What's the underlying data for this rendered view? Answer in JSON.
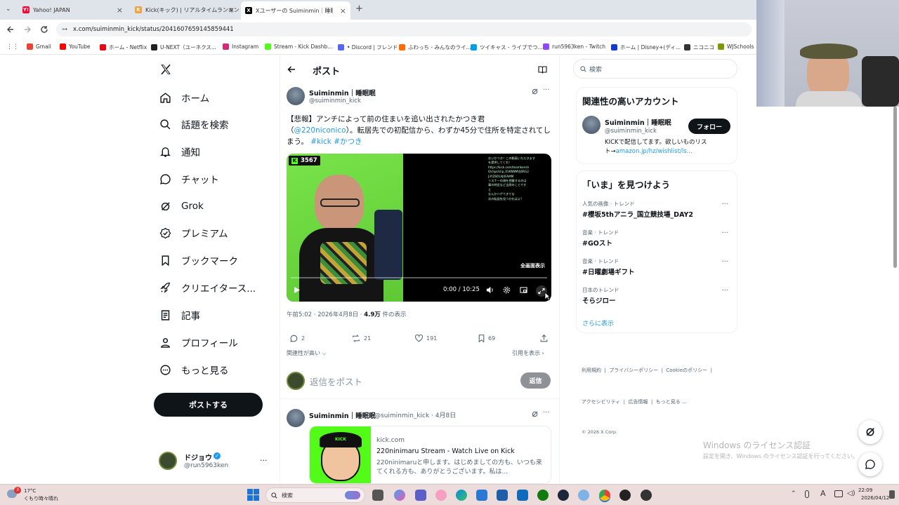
{
  "browser": {
    "tabs": [
      {
        "label": "Yahoo! JAPAN",
        "fav_color": "#ff0033",
        "fav_glyph": "Y!"
      },
      {
        "label": "Kick(キック) | リアルタイムランキング",
        "fav_color": "#f2a23a",
        "fav_glyph": "K"
      },
      {
        "label": "Xユーザーの Suiminmin｜睡眠眠さ",
        "fav_color": "#000000",
        "fav_glyph": "X"
      }
    ],
    "new_tab_glyph": "+",
    "url": "x.com/suiminmin_kick/status/2041607659145859441",
    "bookmarks": [
      {
        "label": "Gmail",
        "color": "#ea4335"
      },
      {
        "label": "YouTube",
        "color": "#ff0000"
      },
      {
        "label": "ホーム - Netflix",
        "color": "#e50914"
      },
      {
        "label": "U-NEXT（ユーネクス...",
        "color": "#222222"
      },
      {
        "label": "Instagram",
        "color": "#d62976"
      },
      {
        "label": "Stream - Kick Dashb...",
        "color": "#53fc18"
      },
      {
        "label": "• Discord | フレンド",
        "color": "#5865f2"
      },
      {
        "label": "ふわっち - みんなのライ...",
        "color": "#ff6a00"
      },
      {
        "label": "ツイキャス - ライブでつ...",
        "color": "#00a0e9"
      },
      {
        "label": "run5963ken - Twitch",
        "color": "#9146ff"
      },
      {
        "label": "ホーム | Disney+(ディ...",
        "color": "#113ccf"
      },
      {
        "label": "ニコニコ",
        "color": "#333333"
      },
      {
        "label": "WJSchools",
        "color": "#7a9a01"
      }
    ]
  },
  "nav": {
    "items": [
      {
        "label": "ホーム",
        "icon": "home-icon"
      },
      {
        "label": "話題を検索",
        "icon": "search-icon"
      },
      {
        "label": "通知",
        "icon": "bell-icon"
      },
      {
        "label": "チャット",
        "icon": "chat-icon"
      },
      {
        "label": "Grok",
        "icon": "grok-icon"
      },
      {
        "label": "プレミアム",
        "icon": "premium-icon"
      },
      {
        "label": "ブックマーク",
        "icon": "bookmark-icon"
      },
      {
        "label": "クリエイタース...",
        "icon": "rocket-icon"
      },
      {
        "label": "記事",
        "icon": "article-icon"
      },
      {
        "label": "プロフィール",
        "icon": "profile-icon"
      },
      {
        "label": "もっと見る",
        "icon": "more-icon"
      }
    ],
    "post_button": "ポストする",
    "account": {
      "name": "ドジョウ",
      "handle": "@run5963ken",
      "more": "···"
    }
  },
  "header": {
    "title": "ポスト"
  },
  "post": {
    "author_name": "Suiminmin｜睡眠眠",
    "author_handle": "@suiminmin_kick",
    "text_1": "【悲報】アンチによって前の住まいを追い出されたかつき君（",
    "mention": "@220niconico",
    "text_2": "）。転居先での初配信から、わずか45分で住所を特定されてしまう。",
    "hashtags": "#kick #かつき",
    "video": {
      "kick_viewers": "3567",
      "time": "0:00 / 10:25",
      "fullscreen_label": "全画面表示",
      "chat_lines": [
        "おいかつき！この動画いただきます",
        "を提供してくれ！",
        "https://kick.com/teamkensh",
        "0/clips/clip_01KNNMVJ6RG2",
        "J3YZ601AJ0FAMM",
        "リスナーの顔を把握するのは",
        "事の特定など当然のことです",
        "と",
        "なんかハゲてきてな",
        "次の転居先見つかればよ？"
      ]
    },
    "meta_time": "午前5:02 · 2026年4月8日 · ",
    "views_count": "4.9万",
    "views_label": " 件の表示",
    "actions": {
      "replies": "2",
      "reposts": "21",
      "likes": "191",
      "bookmarks": "69"
    },
    "sort_label": "関連性が高い",
    "quotes_label": "引用を表示",
    "reply_placeholder": "返信をポスト",
    "reply_button": "返信"
  },
  "reply_post": {
    "author_name": "Suiminmin｜睡眠眠",
    "author_meta": "@suiminmin_kick · 4月8日",
    "link_domain": "kick.com",
    "link_title": "220ninimaru Stream - Watch Live on Kick",
    "link_desc": "220ninimaruと申します。はじめましての方も、いつも来てくれる方も、ありがとうございます。私は..."
  },
  "search": {
    "placeholder": "検索"
  },
  "related": {
    "title": "関連性の高いアカウント",
    "name": "Suiminmin｜睡眠眠",
    "handle": "@suiminmin_kick",
    "follow": "フォロー",
    "bio_1": "KICKで配信してます。欲しいものリス",
    "bio_2": "ト→",
    "bio_link": "amazon.jp/hz/wishlist/ls..."
  },
  "trends": {
    "title": "「いま」を見つけよう",
    "items": [
      {
        "category": "人気の画像 · トレンド",
        "name": "#櫻坂5thアニラ_国立競技場_DAY2"
      },
      {
        "category": "音楽 · トレンド",
        "name": "#GOスト"
      },
      {
        "category": "音楽 · トレンド",
        "name": "#日曜劇場ギフト"
      },
      {
        "category": "日本のトレンド",
        "name": "そらジロー"
      }
    ],
    "more": "さらに表示"
  },
  "footer": {
    "row1": "利用規約  |  プライバシーポリシー  |  Cookieのポリシー  |",
    "row2": "アクセシビリティ  |  広告情報  |  もっと見る ...",
    "row3": "© 2026 X Corp."
  },
  "watermark": {
    "line1": "Windows のライセンス認証",
    "line2": "設定を開き、Windows のライセンス認証を行ってください。"
  },
  "taskbar": {
    "weather_temp": "17°C",
    "weather_desc": "くもり時々晴れ",
    "notif_count": "3",
    "search_label": "検索",
    "time": "22:09",
    "date": "2026/04/12",
    "tray_a": "A"
  }
}
